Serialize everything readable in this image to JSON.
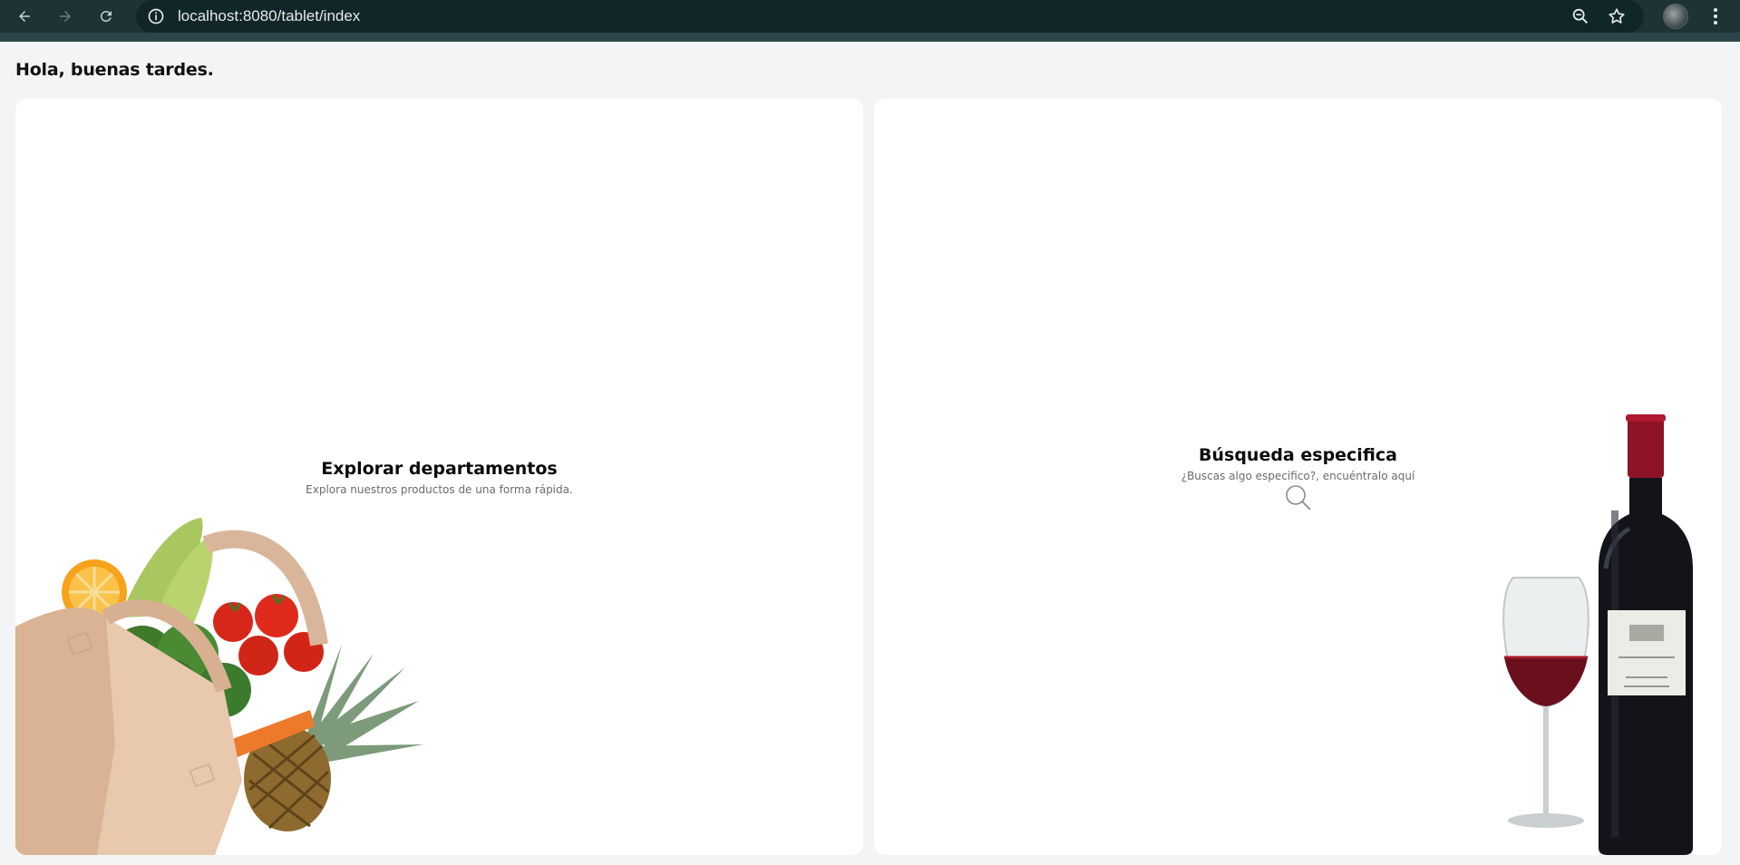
{
  "browser": {
    "url": "localhost:8080/tablet/index",
    "icons": [
      "back-arrow-icon",
      "forward-arrow-icon",
      "reload-icon",
      "site-info-icon",
      "zoom-icon",
      "star-icon",
      "profile-avatar",
      "more-vertical-icon"
    ]
  },
  "page": {
    "greeting": "Hola, buenas tardes.",
    "cards": [
      {
        "title": "Explorar departamentos",
        "subtitle": "Explora nuestros productos de una forma rápida.",
        "illustration": "grocery-bag-illustration"
      },
      {
        "title": "Búsqueda especifica",
        "subtitle": "¿Buscas algo especifico?, encuéntralo aquí",
        "icon": "search-icon",
        "illustration": "wine-bottle-glass-illustration"
      }
    ]
  },
  "colors": {
    "chrome": "#1d3336",
    "urlbar": "#112628",
    "page_bg": "#f3f4f6",
    "card_bg": "#ffffff"
  }
}
